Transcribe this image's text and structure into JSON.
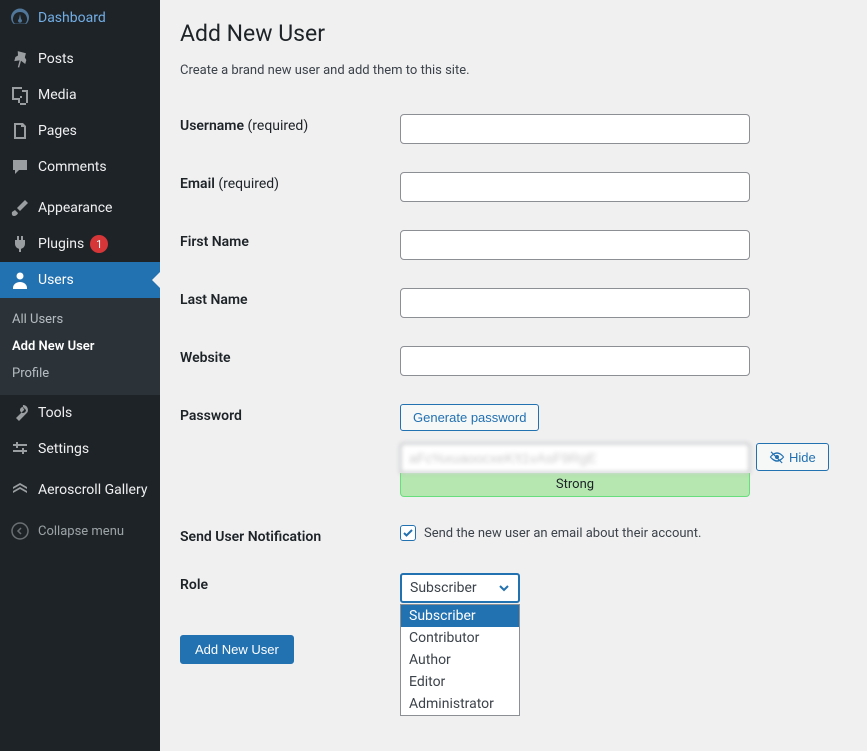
{
  "sidebar": {
    "dashboard": "Dashboard",
    "posts": "Posts",
    "media": "Media",
    "pages": "Pages",
    "comments": "Comments",
    "appearance": "Appearance",
    "plugins": "Plugins",
    "plugins_badge": "1",
    "users": "Users",
    "users_submenu": {
      "all_users": "All Users",
      "add_new": "Add New User",
      "profile": "Profile"
    },
    "tools": "Tools",
    "settings": "Settings",
    "aeroscroll": "Aeroscroll Gallery",
    "collapse": "Collapse menu"
  },
  "page": {
    "title": "Add New User",
    "description": "Create a brand new user and add them to this site."
  },
  "form": {
    "username_label": "Username",
    "username_required": "(required)",
    "email_label": "Email",
    "email_required": "(required)",
    "first_name_label": "First Name",
    "last_name_label": "Last Name",
    "website_label": "Website",
    "password_label": "Password",
    "generate_password_btn": "Generate password",
    "password_value": "aFc%xuaoocxeK!t1vAsF9RgE",
    "password_strength": "Strong",
    "hide_btn": "Hide",
    "notification_label": "Send User Notification",
    "notification_text": "Send the new user an email about their account.",
    "notification_checked": true,
    "role_label": "Role",
    "role_selected": "Subscriber",
    "role_options": [
      "Subscriber",
      "Contributor",
      "Author",
      "Editor",
      "Administrator"
    ],
    "submit_btn": "Add New User"
  }
}
